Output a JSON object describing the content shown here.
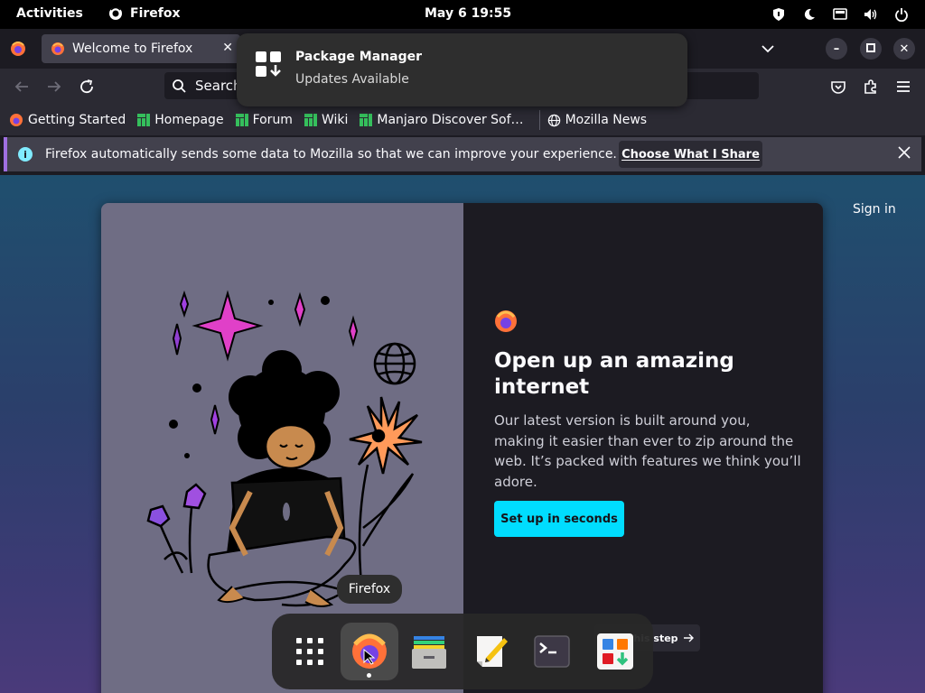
{
  "topbar": {
    "activities": "Activities",
    "app_name": "Firefox",
    "clock": "May 6  19:55"
  },
  "tabs": [
    {
      "label": "Welcome to Firefox",
      "icon": "firefox-icon"
    }
  ],
  "urlbar": {
    "label": "Search"
  },
  "bookmarks": [
    {
      "label": "Getting Started",
      "icon": "firefox-icon"
    },
    {
      "label": "Homepage",
      "icon": "manjaro-icon"
    },
    {
      "label": "Forum",
      "icon": "manjaro-icon"
    },
    {
      "label": "Wiki",
      "icon": "manjaro-icon"
    },
    {
      "label": "Manjaro Discover Sof…",
      "icon": "manjaro-icon"
    },
    {
      "label": "Mozilla News",
      "icon": "globe-icon"
    }
  ],
  "infobar": {
    "text": "Firefox automatically sends some data to Mozilla so that we can improve your experience.",
    "button": "Choose What I Share"
  },
  "notification": {
    "title": "Package Manager",
    "body": "Updates Available"
  },
  "welcome": {
    "sign_in": "Sign in",
    "title": "Open up an amazing internet",
    "body": "Our latest version is built around you, making it easier than ever to zip around the web. It’s packed with features we think you’ll adore.",
    "primary_button": "Set up in seconds",
    "skip_button": "Skip this step"
  },
  "dock": {
    "tooltip": "Firefox",
    "items": [
      "app-grid-icon",
      "firefox-icon",
      "files-icon",
      "text-editor-icon",
      "terminal-icon",
      "software-icon"
    ]
  },
  "colors": {
    "accent": "#00ddff",
    "infobar_border": "#9f6fe0",
    "manjaro_green": "#35bf5c"
  }
}
